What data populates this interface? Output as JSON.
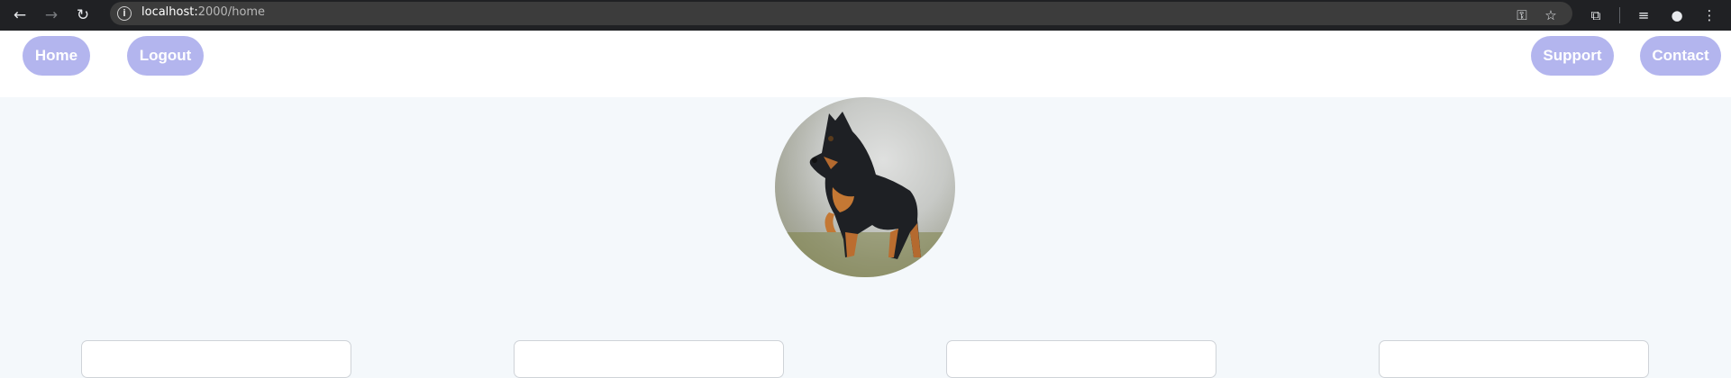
{
  "browser": {
    "url_host": "localhost:",
    "url_path": "2000/home",
    "icons": [
      "back-arrow-icon",
      "forward-arrow-icon",
      "reload-icon",
      "info-icon",
      "password-key-icon",
      "bookmark-star-icon",
      "extensions-icon",
      "reading-list-icon",
      "profile-icon",
      "menu-dots-icon"
    ]
  },
  "nav": {
    "home": "Home",
    "logout": "Logout",
    "support": "Support",
    "contact": "Contact"
  },
  "colors": {
    "accent": "#b3b5ee",
    "page_bg": "#f4f8fb"
  },
  "profile_image": "dog-photo",
  "cards": [
    {},
    {},
    {},
    {}
  ]
}
